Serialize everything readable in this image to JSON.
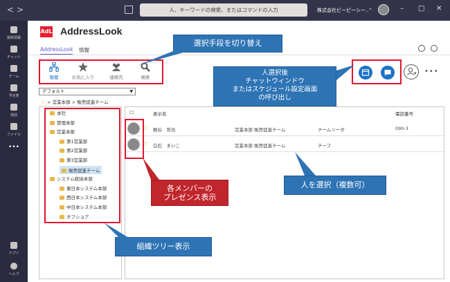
{
  "titlebar": {
    "back": "<",
    "forward": ">",
    "search_placeholder": "人、キーワードの検索、またはコマンドの入力",
    "org_name": "株式会社ビーピーシー..",
    "org_chevron": "⌄",
    "minimize": "–",
    "maximize": "□",
    "close": "✕"
  },
  "rail": {
    "items": [
      {
        "label": "最新情報",
        "icon": "bell-icon"
      },
      {
        "label": "チャット",
        "icon": "chat-icon"
      },
      {
        "label": "チーム",
        "icon": "teams-icon"
      },
      {
        "label": "予定表",
        "icon": "calendar-icon"
      },
      {
        "label": "通話",
        "icon": "phone-icon"
      },
      {
        "label": "ファイル",
        "icon": "file-icon"
      },
      {
        "label": "•••",
        "icon": "more-icon"
      }
    ],
    "bottom": [
      {
        "label": "アプリ",
        "icon": "apps-icon"
      },
      {
        "label": "ヘルプ",
        "icon": "help-icon"
      }
    ]
  },
  "app": {
    "logo": "AdL",
    "title": "AddressLook",
    "tabs": [
      "AddressLook",
      "情報"
    ]
  },
  "toolbar": {
    "buttons": [
      {
        "label": "階層",
        "icon": "hierarchy-icon"
      },
      {
        "label": "お気に入り",
        "icon": "star-icon"
      },
      {
        "label": "連絡先",
        "icon": "contacts-icon"
      },
      {
        "label": "検索",
        "icon": "search-icon"
      }
    ]
  },
  "dropdown": {
    "value": "デフォルト",
    "arrow": "▼"
  },
  "breadcrumb": {
    "text": "> 営業本部 > 販売促進チーム"
  },
  "tree": [
    {
      "label": "本社",
      "level": 0
    },
    {
      "label": "管理本部",
      "level": 0
    },
    {
      "label": "営業本部",
      "level": 0
    },
    {
      "label": "第1営業部",
      "level": 1
    },
    {
      "label": "第2営業部",
      "level": 1
    },
    {
      "label": "第3営業部",
      "level": 1
    },
    {
      "label": "販売促進チーム",
      "level": 1
    },
    {
      "label": "システム統括本部",
      "level": 0
    },
    {
      "label": "東日本システム本部",
      "level": 1
    },
    {
      "label": "西日本システム本部",
      "level": 1
    },
    {
      "label": "中日本システム本部",
      "level": 1
    },
    {
      "label": "オフショア",
      "level": 1
    }
  ],
  "grid": {
    "headers": {
      "name": "表示名",
      "phone": "電話番号"
    },
    "rows": [
      {
        "name": "桐谷　哲也",
        "dept": "営業本部 販売促進チーム",
        "title": "チームリーダ",
        "phone": "090-3"
      },
      {
        "name": "白石　まいこ",
        "dept": "営業本部 販売促進チーム",
        "title": "チーフ",
        "phone": ""
      }
    ]
  },
  "callouts": {
    "switch": "選択手段を切り替え",
    "chat": "人選択後\nチャットウィンドウ\nまたはスケジュール設定画面\nの呼び出し",
    "presence": "各メンバーの\nプレゼンス表示",
    "select": "人を選択（複数可）",
    "tree": "組織ツリー表示"
  },
  "colors": {
    "titlebar": "#33344a",
    "rail": "#2b2b40",
    "accent": "#1e72c8",
    "callout_blue": "#2e74b5",
    "callout_red": "#c0262c",
    "highlight": "#e1142d"
  }
}
